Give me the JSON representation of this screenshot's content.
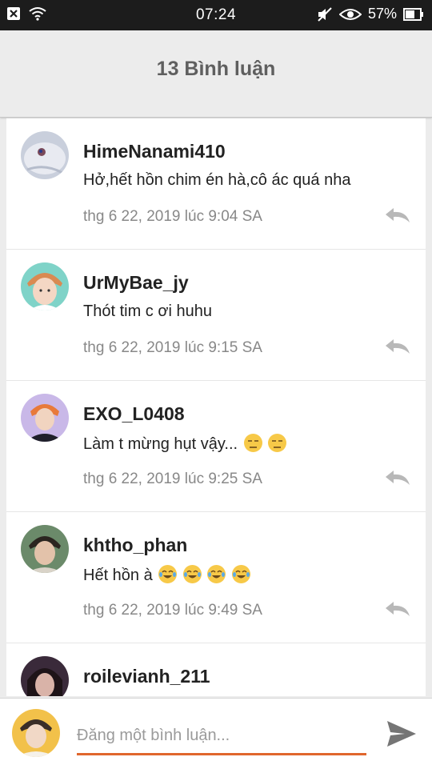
{
  "status_bar": {
    "time": "07:24",
    "battery": "57%",
    "icons": [
      "close-box-icon",
      "wifi-icon",
      "mute-icon",
      "eye-icon",
      "battery-icon"
    ]
  },
  "header": {
    "title": "13 Bình luận"
  },
  "comments": [
    {
      "username": "HimeNanami410",
      "text": "Hở,hết hồn chim én hà,cô ác quá nha",
      "timestamp": "thg 6 22, 2019 lúc 9:04 SA"
    },
    {
      "username": "UrMyBae_jy",
      "text": "Thót tim c ơi huhu",
      "timestamp": "thg 6 22, 2019 lúc 9:15 SA"
    },
    {
      "username": "EXO_L0408",
      "text": "Làm t mừng hụt vậy...",
      "emoji": [
        "unamused-emoji",
        "unamused-emoji"
      ],
      "timestamp": "thg 6 22, 2019 lúc 9:25 SA"
    },
    {
      "username": "khtho_phan",
      "text": "Hết hồn à",
      "emoji": [
        "tears-of-joy-emoji",
        "tears-of-joy-emoji",
        "tears-of-joy-emoji",
        "tears-of-joy-emoji"
      ],
      "timestamp": "thg 6 22, 2019 lúc 9:49 SA"
    },
    {
      "username": "roilevianh_211",
      "text": "",
      "timestamp": ""
    }
  ],
  "composer": {
    "placeholder": "Đăng một bình luận...",
    "value": "",
    "accent_color": "#e0662d"
  },
  "colors": {
    "status_bar": "#1c1c1c",
    "header_bg": "#ececec",
    "header_text": "#5f5f5f",
    "timestamp": "#888888"
  }
}
